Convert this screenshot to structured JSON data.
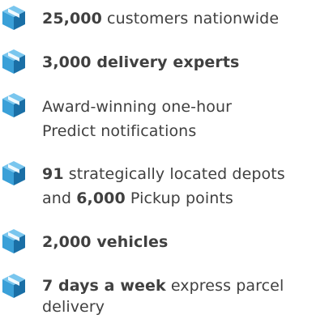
{
  "colors": {
    "text": "#404040",
    "icon_main": "#3aa0d8",
    "icon_light": "#79c6ee",
    "icon_dark": "#1a6fa6"
  },
  "icon_name": "parcel-box-icon",
  "items": [
    {
      "bold1": "25,000",
      "rest1": " customers nationwide"
    },
    {
      "bold1": "3,000 delivery experts"
    },
    {
      "line1": "Award-winning one-hour",
      "line2": "Predict notifications"
    },
    {
      "bold1": "91",
      "rest1": " strategically located depots",
      "line2a": "and ",
      "bold2": "6,000",
      "line2b": " Pickup points"
    },
    {
      "bold1": "2,000 vehicles"
    },
    {
      "bold1": "7 days a week",
      "rest1": " express parcel",
      "line2": "delivery"
    }
  ]
}
